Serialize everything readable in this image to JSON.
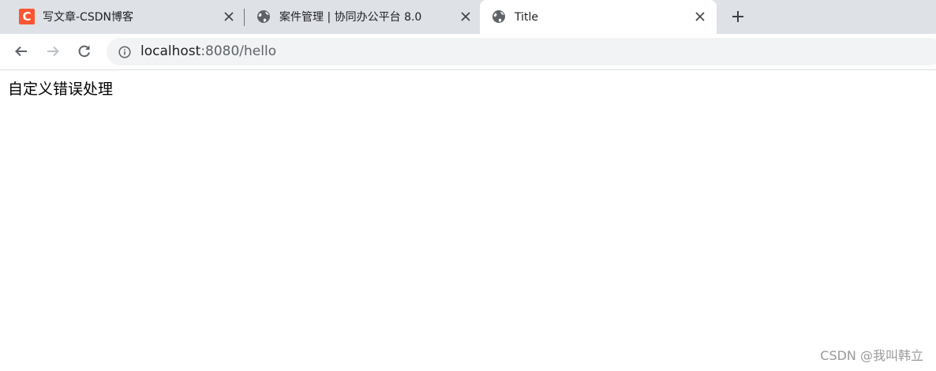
{
  "tabs": [
    {
      "title": "写文章-CSDN博客",
      "favicon": "csdn-icon",
      "favicon_letter": "C",
      "active": false
    },
    {
      "title": "案件管理 | 协同办公平台 8.0",
      "favicon": "globe-icon",
      "active": false
    },
    {
      "title": "Title",
      "favicon": "globe-icon",
      "active": true
    }
  ],
  "address_bar": {
    "host": "localhost",
    "path": ":8080/hello"
  },
  "page": {
    "text": "自定义错误处理"
  },
  "watermark": "CSDN @我叫韩立",
  "colors": {
    "tabstrip_bg": "#dee1e6",
    "csdn_brand": "#fc5531",
    "omnibox_bg": "#f1f3f4",
    "icon": "#5f6368"
  }
}
